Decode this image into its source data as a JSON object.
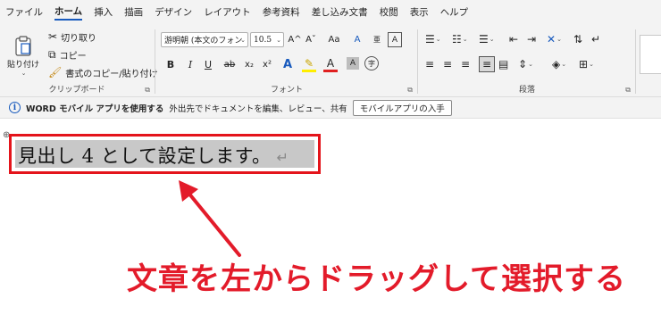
{
  "tabs": [
    "ファイル",
    "ホーム",
    "挿入",
    "描画",
    "デザイン",
    "レイアウト",
    "参考資料",
    "差し込み文書",
    "校閲",
    "表示",
    "ヘルプ"
  ],
  "clipboard": {
    "paste_label": "貼り付け",
    "cut_label": "切り取り",
    "copy_label": "コピー",
    "format_painter_label": "書式のコピー/貼り付け",
    "group_label": "クリップボード"
  },
  "font": {
    "font_name": "游明朝 (本文のフォン",
    "font_size": "10.5",
    "bold": "B",
    "italic": "I",
    "underline": "U",
    "strike": "ab",
    "subscript": "x₂",
    "superscript": "x²",
    "effect": "A",
    "highlight": "✎",
    "font_color": "A",
    "char_shading": "A",
    "enclose": "字",
    "grow": "A^",
    "shrink": "Aˇ",
    "change_case": "Aa",
    "clear_format": "A",
    "phonetic": "亜",
    "border": "A",
    "group_label": "フォント"
  },
  "paragraph": {
    "group_label": "段落"
  },
  "infobar": {
    "bold_text": "WORD モバイル アプリを使用する",
    "text": "外出先でドキュメントを編集、レビュー、共有",
    "button_label": "モバイルアプリの入手"
  },
  "document": {
    "heading_text": "見出し 4 として設定します。",
    "return_mark": "↵",
    "anchor_mark": "⊕"
  },
  "annotation": {
    "text": "文章を左からドラッグして選択する"
  },
  "colors": {
    "accent": "#185abd",
    "annotation_red": "#e31b2a",
    "selection_gray": "#c8c8c8",
    "ribbon_bg": "#f3f3f3"
  }
}
